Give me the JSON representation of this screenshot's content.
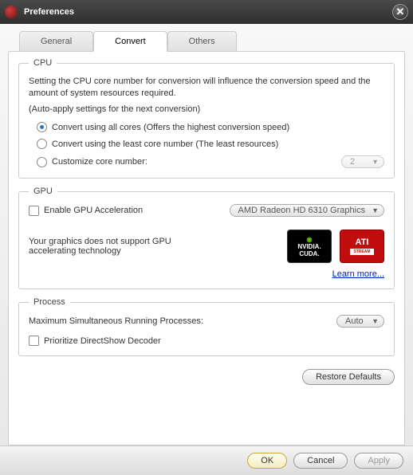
{
  "window": {
    "title": "Preferences"
  },
  "tabs": {
    "general": "General",
    "convert": "Convert",
    "others": "Others"
  },
  "cpu": {
    "legend": "CPU",
    "desc": "Setting the CPU core number for conversion will influence the conversion speed and the amount of system resources required.",
    "autoapply": "(Auto-apply settings for the next conversion)",
    "opt_all": "Convert using all cores (Offers the highest conversion speed)",
    "opt_least": "Convert using the least core number (The least resources)",
    "opt_custom": "Customize core number:",
    "custom_value": "2"
  },
  "gpu": {
    "legend": "GPU",
    "enable_label": "Enable GPU Acceleration",
    "device": "AMD Radeon HD 6310 Graphics",
    "nosupport": "Your graphics does not support GPU accelerating technology",
    "learn": "Learn more...",
    "badge_cuda_top": "NVIDIA.",
    "badge_cuda_bot": "CUDA.",
    "badge_ati": "ATI",
    "badge_ati_sub": "STREAM"
  },
  "process": {
    "legend": "Process",
    "max_label": "Maximum Simultaneous Running Processes:",
    "max_value": "Auto",
    "prioritize": "Prioritize DirectShow Decoder"
  },
  "buttons": {
    "restore": "Restore Defaults",
    "ok": "OK",
    "cancel": "Cancel",
    "apply": "Apply"
  }
}
